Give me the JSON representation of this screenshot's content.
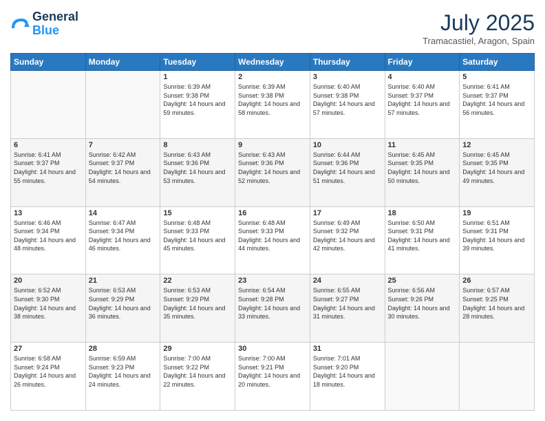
{
  "logo": {
    "line1": "General",
    "line2": "Blue"
  },
  "title": "July 2025",
  "location": "Tramacastiel, Aragon, Spain",
  "days_of_week": [
    "Sunday",
    "Monday",
    "Tuesday",
    "Wednesday",
    "Thursday",
    "Friday",
    "Saturday"
  ],
  "weeks": [
    [
      {
        "day": "",
        "sunrise": "",
        "sunset": "",
        "daylight": ""
      },
      {
        "day": "",
        "sunrise": "",
        "sunset": "",
        "daylight": ""
      },
      {
        "day": "1",
        "sunrise": "Sunrise: 6:39 AM",
        "sunset": "Sunset: 9:38 PM",
        "daylight": "Daylight: 14 hours and 59 minutes."
      },
      {
        "day": "2",
        "sunrise": "Sunrise: 6:39 AM",
        "sunset": "Sunset: 9:38 PM",
        "daylight": "Daylight: 14 hours and 58 minutes."
      },
      {
        "day": "3",
        "sunrise": "Sunrise: 6:40 AM",
        "sunset": "Sunset: 9:38 PM",
        "daylight": "Daylight: 14 hours and 57 minutes."
      },
      {
        "day": "4",
        "sunrise": "Sunrise: 6:40 AM",
        "sunset": "Sunset: 9:37 PM",
        "daylight": "Daylight: 14 hours and 57 minutes."
      },
      {
        "day": "5",
        "sunrise": "Sunrise: 6:41 AM",
        "sunset": "Sunset: 9:37 PM",
        "daylight": "Daylight: 14 hours and 56 minutes."
      }
    ],
    [
      {
        "day": "6",
        "sunrise": "Sunrise: 6:41 AM",
        "sunset": "Sunset: 9:37 PM",
        "daylight": "Daylight: 14 hours and 55 minutes."
      },
      {
        "day": "7",
        "sunrise": "Sunrise: 6:42 AM",
        "sunset": "Sunset: 9:37 PM",
        "daylight": "Daylight: 14 hours and 54 minutes."
      },
      {
        "day": "8",
        "sunrise": "Sunrise: 6:43 AM",
        "sunset": "Sunset: 9:36 PM",
        "daylight": "Daylight: 14 hours and 53 minutes."
      },
      {
        "day": "9",
        "sunrise": "Sunrise: 6:43 AM",
        "sunset": "Sunset: 9:36 PM",
        "daylight": "Daylight: 14 hours and 52 minutes."
      },
      {
        "day": "10",
        "sunrise": "Sunrise: 6:44 AM",
        "sunset": "Sunset: 9:36 PM",
        "daylight": "Daylight: 14 hours and 51 minutes."
      },
      {
        "day": "11",
        "sunrise": "Sunrise: 6:45 AM",
        "sunset": "Sunset: 9:35 PM",
        "daylight": "Daylight: 14 hours and 50 minutes."
      },
      {
        "day": "12",
        "sunrise": "Sunrise: 6:45 AM",
        "sunset": "Sunset: 9:35 PM",
        "daylight": "Daylight: 14 hours and 49 minutes."
      }
    ],
    [
      {
        "day": "13",
        "sunrise": "Sunrise: 6:46 AM",
        "sunset": "Sunset: 9:34 PM",
        "daylight": "Daylight: 14 hours and 48 minutes."
      },
      {
        "day": "14",
        "sunrise": "Sunrise: 6:47 AM",
        "sunset": "Sunset: 9:34 PM",
        "daylight": "Daylight: 14 hours and 46 minutes."
      },
      {
        "day": "15",
        "sunrise": "Sunrise: 6:48 AM",
        "sunset": "Sunset: 9:33 PM",
        "daylight": "Daylight: 14 hours and 45 minutes."
      },
      {
        "day": "16",
        "sunrise": "Sunrise: 6:48 AM",
        "sunset": "Sunset: 9:33 PM",
        "daylight": "Daylight: 14 hours and 44 minutes."
      },
      {
        "day": "17",
        "sunrise": "Sunrise: 6:49 AM",
        "sunset": "Sunset: 9:32 PM",
        "daylight": "Daylight: 14 hours and 42 minutes."
      },
      {
        "day": "18",
        "sunrise": "Sunrise: 6:50 AM",
        "sunset": "Sunset: 9:31 PM",
        "daylight": "Daylight: 14 hours and 41 minutes."
      },
      {
        "day": "19",
        "sunrise": "Sunrise: 6:51 AM",
        "sunset": "Sunset: 9:31 PM",
        "daylight": "Daylight: 14 hours and 39 minutes."
      }
    ],
    [
      {
        "day": "20",
        "sunrise": "Sunrise: 6:52 AM",
        "sunset": "Sunset: 9:30 PM",
        "daylight": "Daylight: 14 hours and 38 minutes."
      },
      {
        "day": "21",
        "sunrise": "Sunrise: 6:53 AM",
        "sunset": "Sunset: 9:29 PM",
        "daylight": "Daylight: 14 hours and 36 minutes."
      },
      {
        "day": "22",
        "sunrise": "Sunrise: 6:53 AM",
        "sunset": "Sunset: 9:29 PM",
        "daylight": "Daylight: 14 hours and 35 minutes."
      },
      {
        "day": "23",
        "sunrise": "Sunrise: 6:54 AM",
        "sunset": "Sunset: 9:28 PM",
        "daylight": "Daylight: 14 hours and 33 minutes."
      },
      {
        "day": "24",
        "sunrise": "Sunrise: 6:55 AM",
        "sunset": "Sunset: 9:27 PM",
        "daylight": "Daylight: 14 hours and 31 minutes."
      },
      {
        "day": "25",
        "sunrise": "Sunrise: 6:56 AM",
        "sunset": "Sunset: 9:26 PM",
        "daylight": "Daylight: 14 hours and 30 minutes."
      },
      {
        "day": "26",
        "sunrise": "Sunrise: 6:57 AM",
        "sunset": "Sunset: 9:25 PM",
        "daylight": "Daylight: 14 hours and 28 minutes."
      }
    ],
    [
      {
        "day": "27",
        "sunrise": "Sunrise: 6:58 AM",
        "sunset": "Sunset: 9:24 PM",
        "daylight": "Daylight: 14 hours and 26 minutes."
      },
      {
        "day": "28",
        "sunrise": "Sunrise: 6:59 AM",
        "sunset": "Sunset: 9:23 PM",
        "daylight": "Daylight: 14 hours and 24 minutes."
      },
      {
        "day": "29",
        "sunrise": "Sunrise: 7:00 AM",
        "sunset": "Sunset: 9:22 PM",
        "daylight": "Daylight: 14 hours and 22 minutes."
      },
      {
        "day": "30",
        "sunrise": "Sunrise: 7:00 AM",
        "sunset": "Sunset: 9:21 PM",
        "daylight": "Daylight: 14 hours and 20 minutes."
      },
      {
        "day": "31",
        "sunrise": "Sunrise: 7:01 AM",
        "sunset": "Sunset: 9:20 PM",
        "daylight": "Daylight: 14 hours and 18 minutes."
      },
      {
        "day": "",
        "sunrise": "",
        "sunset": "",
        "daylight": ""
      },
      {
        "day": "",
        "sunrise": "",
        "sunset": "",
        "daylight": ""
      }
    ]
  ]
}
